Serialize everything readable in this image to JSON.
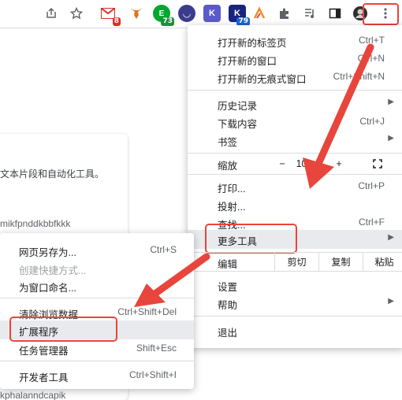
{
  "toolbar": {
    "icons": [
      "share-icon",
      "star-icon",
      "gmail-icon",
      "metamask-icon",
      "evernote-icon",
      "chat-icon",
      "k-extension-icon",
      "k-extension-2-icon",
      "x-extension-icon",
      "puzzle-icon",
      "music-icon",
      "sidepanel-icon",
      "profile-icon",
      "more-icon"
    ],
    "badges": {
      "gmail": "8",
      "evernote": "73",
      "k2": "79"
    }
  },
  "page": {
    "line1": "文本片段和自动化工具。",
    "line2": "mikfpnddkbbfkkk",
    "line3": "kphalanndcapik"
  },
  "main_menu": {
    "new_tab": {
      "label": "打开新的标签页",
      "shortcut": "Ctrl+T"
    },
    "new_window": {
      "label": "打开新的窗口",
      "shortcut": "Ctrl+N"
    },
    "incognito": {
      "label": "打开新的无痕式窗口",
      "shortcut": "Ctrl+Shift+N"
    },
    "history": {
      "label": "历史记录"
    },
    "downloads": {
      "label": "下载内容",
      "shortcut": "Ctrl+J"
    },
    "bookmarks": {
      "label": "书签"
    },
    "zoom": {
      "label": "缩放",
      "minus": "−",
      "value": "100",
      "plus": "+"
    },
    "print": {
      "label": "打印...",
      "shortcut": "Ctrl+P"
    },
    "cast": {
      "label": "投射..."
    },
    "find": {
      "label": "查找...",
      "shortcut": "Ctrl+F"
    },
    "more_tools": {
      "label": "更多工具"
    },
    "edit": {
      "label": "编辑",
      "cut": "剪切",
      "copy": "复制",
      "paste": "粘贴"
    },
    "settings": {
      "label": "设置"
    },
    "help": {
      "label": "帮助"
    },
    "exit": {
      "label": "退出"
    }
  },
  "sub_menu": {
    "save_page": {
      "label": "网页另存为...",
      "shortcut": "Ctrl+S"
    },
    "create_shortcut": {
      "label": "创建快捷方式..."
    },
    "name_window": {
      "label": "为窗口命名..."
    },
    "clear_data": {
      "label": "清除浏览数据...",
      "shortcut": "Ctrl+Shift+Del"
    },
    "extensions": {
      "label": "扩展程序"
    },
    "task_manager": {
      "label": "任务管理器",
      "shortcut": "Shift+Esc"
    },
    "dev_tools": {
      "label": "开发者工具",
      "shortcut": "Ctrl+Shift+I"
    }
  },
  "colors": {
    "annotation": "#e8453c",
    "highlight": "#e8eaed"
  }
}
